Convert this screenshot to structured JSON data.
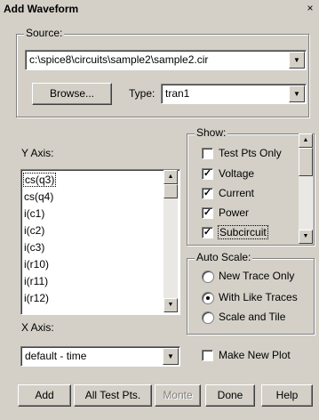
{
  "window": {
    "title": "Add Waveform",
    "close_glyph": "×"
  },
  "source": {
    "legend": "Source:",
    "path": "c:\\spice8\\circuits\\sample2\\sample2.cir",
    "browse_label": "Browse...",
    "type_label": "Type:",
    "type_value": "tran1"
  },
  "y_axis": {
    "label": "Y Axis:",
    "items": [
      "cs(q3)",
      "cs(q4)",
      "i(c1)",
      "i(c2)",
      "i(c3)",
      "i(r10)",
      "i(r11)",
      "i(r12)"
    ],
    "selected_index": 0
  },
  "show": {
    "legend": "Show:",
    "items": [
      {
        "label": "Test Pts Only",
        "checked": false
      },
      {
        "label": "Voltage",
        "checked": true
      },
      {
        "label": "Current",
        "checked": true
      },
      {
        "label": "Power",
        "checked": true
      },
      {
        "label": "Subcircuit",
        "checked": true
      }
    ]
  },
  "auto_scale": {
    "legend": "Auto Scale:",
    "options": [
      {
        "label": "New Trace Only",
        "selected": false
      },
      {
        "label": "With Like Traces",
        "selected": true
      },
      {
        "label": "Scale and Tile",
        "selected": false
      }
    ]
  },
  "x_axis": {
    "label": "X Axis:",
    "value": "default - time"
  },
  "make_new_plot": {
    "label": "Make New Plot",
    "checked": false
  },
  "buttons": {
    "add": "Add",
    "all_test_pts": "All Test Pts.",
    "monte": "Monte",
    "done": "Done",
    "help": "Help"
  },
  "icons": {
    "dropdown": "▼",
    "scroll_up": "▲",
    "scroll_down": "▼",
    "check": "✓"
  }
}
